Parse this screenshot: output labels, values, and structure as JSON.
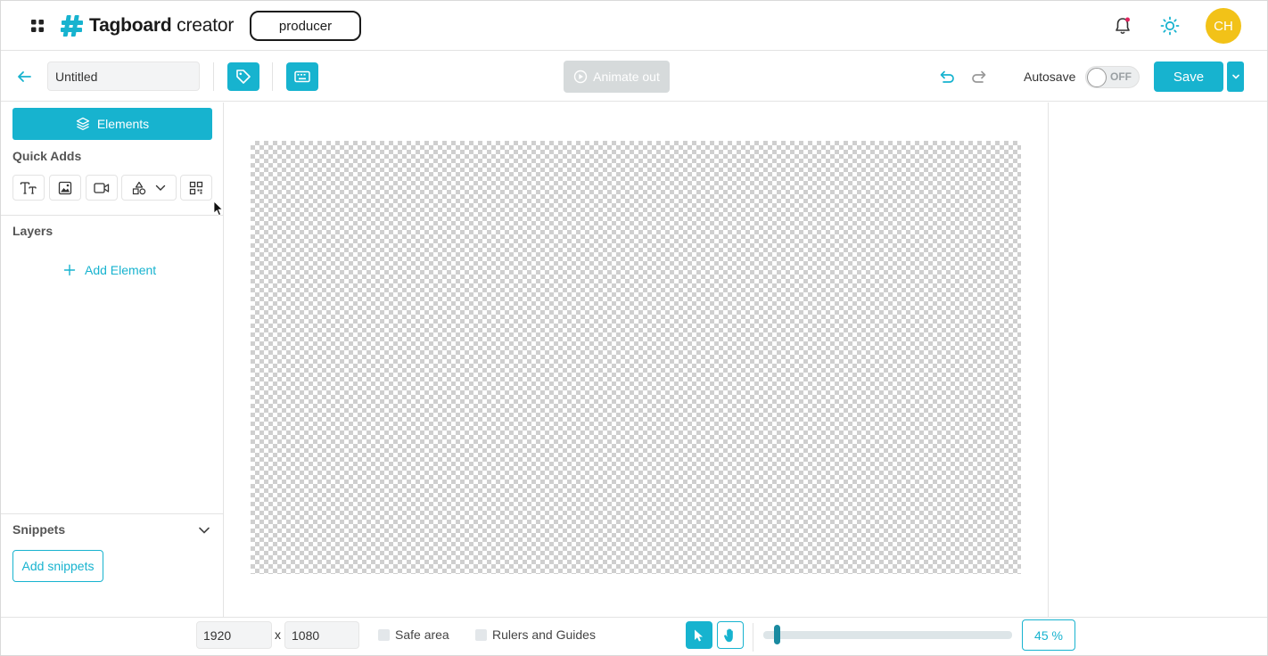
{
  "app": {
    "brand_bold": "Tagboard",
    "brand_light": " creator",
    "role": "producer",
    "avatar_initials": "CH",
    "accent_color": "#17b3cf",
    "avatar_color": "#f2c218"
  },
  "toolbar": {
    "title_value": "Untitled",
    "animate_label": "Animate out",
    "autosave_label": "Autosave",
    "autosave_state": "OFF",
    "save_label": "Save"
  },
  "left_panel": {
    "elements_label": "Elements",
    "quick_adds_title": "Quick Adds",
    "quick_adds": [
      "text-icon",
      "image-icon",
      "video-icon",
      "shapes-icon",
      "qr-code-icon"
    ],
    "layers_title": "Layers",
    "add_element_label": "Add Element",
    "snippets_title": "Snippets",
    "add_snippets_label": "Add snippets"
  },
  "bottom_bar": {
    "width_value": "1920",
    "separator": "x",
    "height_value": "1080",
    "safe_area_label": "Safe area",
    "rulers_label": "Rulers and Guides",
    "zoom_percent": 45,
    "zoom_label": "45 %"
  }
}
